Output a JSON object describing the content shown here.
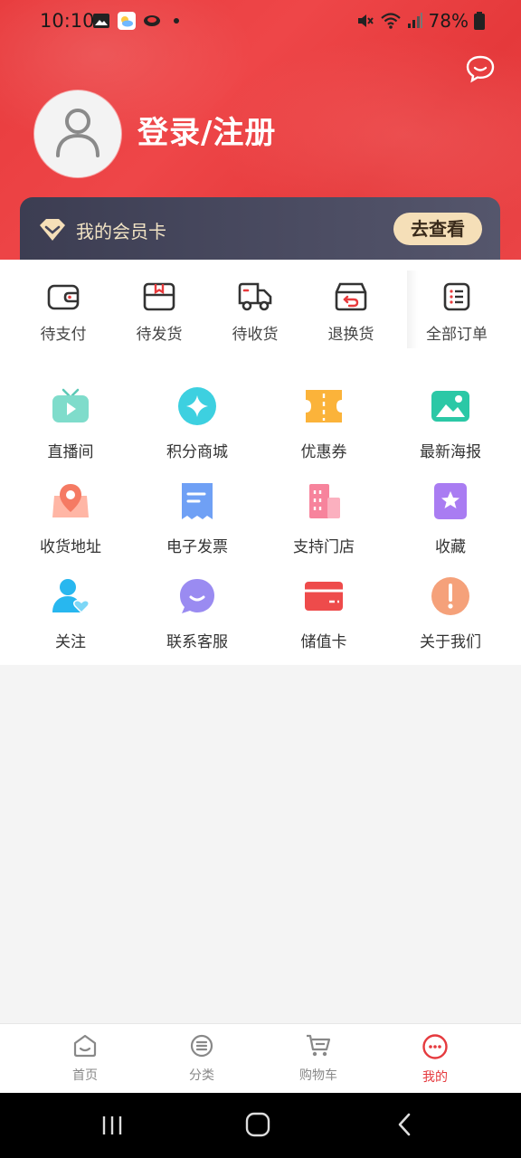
{
  "status_bar": {
    "time": "10:10",
    "battery": "78%",
    "icons": [
      "gallery-icon",
      "weather-icon",
      "app-icon",
      "mute-icon",
      "wifi-icon",
      "signal-icon",
      "battery-icon"
    ]
  },
  "header": {
    "login_label": "登录/注册",
    "vip_label": "我的会员卡",
    "vip_button": "去查看"
  },
  "orders": [
    {
      "label": "待支付",
      "icon": "wallet-icon"
    },
    {
      "label": "待发货",
      "icon": "package-icon"
    },
    {
      "label": "待收货",
      "icon": "truck-icon"
    },
    {
      "label": "退换货",
      "icon": "return-icon"
    },
    {
      "label": "全部订单",
      "icon": "order-list-icon"
    }
  ],
  "services": [
    {
      "label": "直播间",
      "icon": "live-tv-icon"
    },
    {
      "label": "积分商城",
      "icon": "points-star-icon"
    },
    {
      "label": "优惠券",
      "icon": "coupon-icon"
    },
    {
      "label": "最新海报",
      "icon": "poster-image-icon"
    },
    {
      "label": "收货地址",
      "icon": "map-pin-icon"
    },
    {
      "label": "电子发票",
      "icon": "invoice-icon"
    },
    {
      "label": "支持门店",
      "icon": "store-building-icon"
    },
    {
      "label": "收藏",
      "icon": "favorite-star-icon"
    },
    {
      "label": "关注",
      "icon": "follow-user-icon"
    },
    {
      "label": "联系客服",
      "icon": "service-chat-icon"
    },
    {
      "label": "储值卡",
      "icon": "stored-value-card-icon"
    },
    {
      "label": "关于我们",
      "icon": "about-info-icon"
    }
  ],
  "tabbar": [
    {
      "label": "首页",
      "icon": "home-icon",
      "active": false
    },
    {
      "label": "分类",
      "icon": "category-icon",
      "active": false
    },
    {
      "label": "购物车",
      "icon": "cart-icon",
      "active": false
    },
    {
      "label": "我的",
      "icon": "profile-face-icon",
      "active": true
    }
  ],
  "colors": {
    "brand_red": "#e83a3c",
    "active_tab": "#e53a3e",
    "vip_card": "#44455a",
    "vip_button": "#f5dfb8"
  }
}
